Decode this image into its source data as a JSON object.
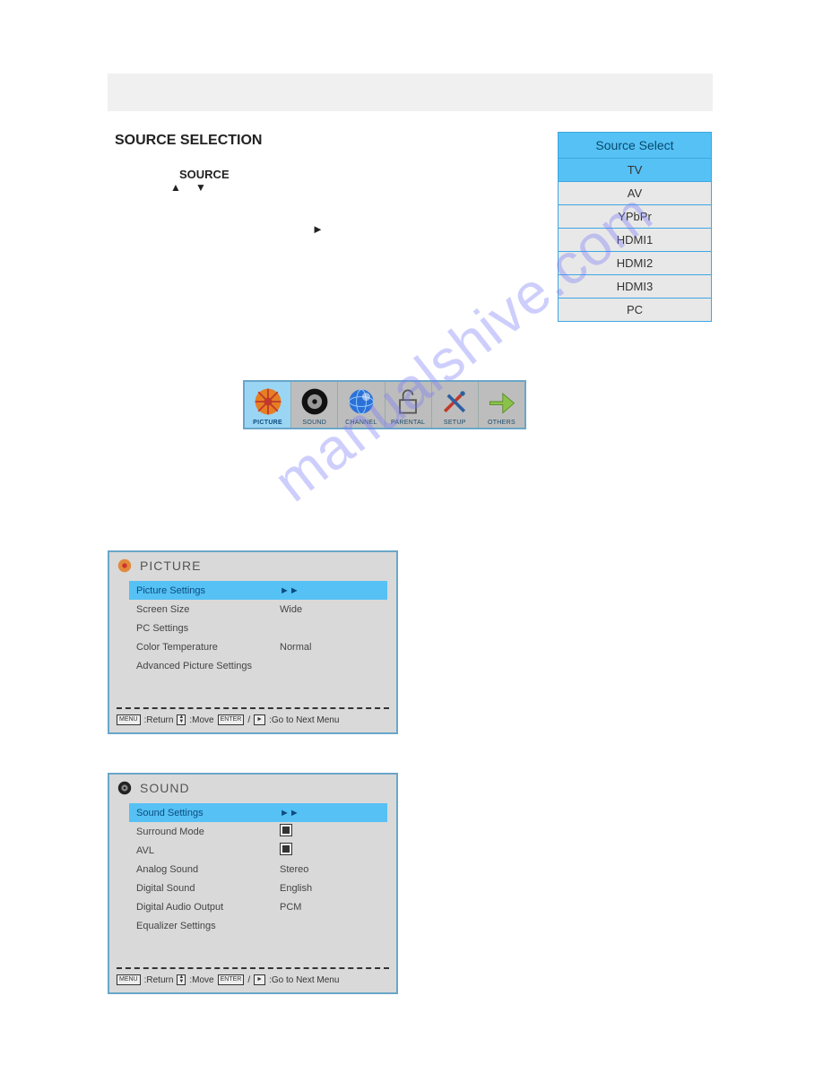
{
  "watermark": "manualshive.com",
  "headings": {
    "source_selection": "SOURCE SELECTION",
    "source_label": "SOURCE"
  },
  "glyphs": {
    "tri_up": "▲",
    "tri_down": "▼",
    "tri_play": "►",
    "dbl_play": "►►"
  },
  "source_table": {
    "title": "Source Select",
    "items": [
      {
        "label": "TV",
        "selected": true
      },
      {
        "label": "AV",
        "selected": false
      },
      {
        "label": "YPbPr",
        "selected": false
      },
      {
        "label": "HDMI1",
        "selected": false
      },
      {
        "label": "HDMI2",
        "selected": false
      },
      {
        "label": "HDMI3",
        "selected": false
      },
      {
        "label": "PC",
        "selected": false
      }
    ]
  },
  "iconbar": [
    {
      "label": "PICTURE",
      "icon": "sunburst-icon",
      "active": true
    },
    {
      "label": "SOUND",
      "icon": "speaker-icon",
      "active": false
    },
    {
      "label": "CHANNEL",
      "icon": "globe-icon",
      "active": false
    },
    {
      "label": "PARENTAL",
      "icon": "lock-icon",
      "active": false
    },
    {
      "label": "SETUP",
      "icon": "tools-icon",
      "active": false
    },
    {
      "label": "OTHERS",
      "icon": "arrow-icon",
      "active": false
    }
  ],
  "picture_panel": {
    "title": "PICTURE",
    "rows": [
      {
        "k": "Picture Settings",
        "v": "►►",
        "selected": true
      },
      {
        "k": "Screen Size",
        "v": "Wide",
        "selected": false
      },
      {
        "k": "PC Settings",
        "v": "",
        "selected": false
      },
      {
        "k": "Color Temperature",
        "v": "Normal",
        "selected": false
      },
      {
        "k": "Advanced Picture Settings",
        "v": "",
        "selected": false
      }
    ],
    "footer": {
      "menu": "MENU",
      "return": ":Return",
      "move": ":Move",
      "enter": "ENTER",
      "slash": "/",
      "goto": ":Go to Next Menu"
    }
  },
  "sound_panel": {
    "title": "SOUND",
    "rows": [
      {
        "k": "Sound Settings",
        "v": "►►",
        "selected": true,
        "check": false
      },
      {
        "k": "Surround Mode",
        "v": "",
        "selected": false,
        "check": true
      },
      {
        "k": "AVL",
        "v": "",
        "selected": false,
        "check": true
      },
      {
        "k": "Analog Sound",
        "v": "Stereo",
        "selected": false,
        "check": false
      },
      {
        "k": "Digital Sound",
        "v": "English",
        "selected": false,
        "check": false
      },
      {
        "k": "Digital Audio Output",
        "v": "PCM",
        "selected": false,
        "check": false
      },
      {
        "k": "Equalizer Settings",
        "v": "",
        "selected": false,
        "check": false
      }
    ],
    "footer": {
      "menu": "MENU",
      "return": ":Return",
      "move": ":Move",
      "enter": "ENTER",
      "slash": "/",
      "goto": ":Go to Next Menu"
    }
  }
}
